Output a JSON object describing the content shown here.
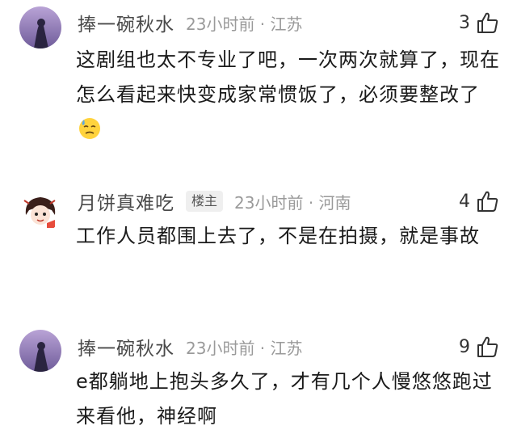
{
  "comments": [
    {
      "username": "捧一碗秋水",
      "badge": "",
      "meta": "23小时前 · 江苏",
      "likes": "3",
      "text": "这剧组也太不专业了吧，一次两次就算了，现在怎么看起来快变成家常惯饭了，必须要整改了",
      "emoji": "sweat-face-icon"
    },
    {
      "username": "月饼真难吃",
      "badge": "楼主",
      "meta": "23小时前 · 河南",
      "likes": "4",
      "text": "工作人员都围上去了，不是在拍摄，就是事故"
    },
    {
      "username": "捧一碗秋水",
      "badge": "",
      "meta": "23小时前 · 江苏",
      "likes": "9",
      "text": "e都躺地上抱头多久了，才有几个人慢悠悠跑过来看他，神经啊"
    }
  ]
}
